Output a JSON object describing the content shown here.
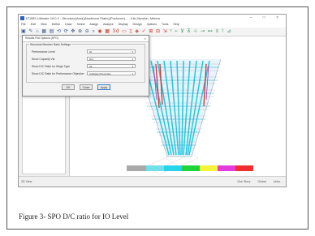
{
  "window": {
    "title": "ETABS Ultimate 18.0.2 - Structure(Area)(Nonlinear Static)(Pushover)... - Kilo-Newton, Meters",
    "controls": "– □ ×"
  },
  "menu": [
    "File",
    "Edit",
    "View",
    "Define",
    "Draw",
    "Select",
    "Assign",
    "Analyze",
    "Display",
    "Design",
    "Options",
    "Tools",
    "Help"
  ],
  "toolbar": {
    "icons_a": "▣ ✎ ⌂ ▦ ▤ ⟲ ⟳ ✥ ⊕ ⊖ ⌕",
    "icons_b": "◉ ▦ 3d ▭ ▯ ◈ ✓ ⊞ ⊟ ⇲",
    "icons_c": "ᵛ ⌁ ⊻ ⊼ ⊹ ⊸ ⊷ ≡ ⊺ ⊿"
  },
  "dialog": {
    "title": "Results Plot Options (SPO)",
    "close": "×",
    "group_caption": "Structural Member Ratio Settings",
    "rows": [
      {
        "label": "Performance Level",
        "value": "IO"
      },
      {
        "label": "Show Capacity Via",
        "value": "D/C"
      },
      {
        "label": "Show D/C Ratio for Hinge Type",
        "value": "All"
      },
      {
        "label": "Show D/C Ratio for Performance Objective",
        "value": "Collapse Prevention"
      }
    ],
    "buttons": {
      "ok": "OK",
      "close": "Close",
      "apply": "Apply"
    }
  },
  "status": {
    "left": "3D View",
    "right": [
      "One Story",
      "Global",
      "Units..."
    ]
  },
  "colorbar": [
    "#a9a9a9",
    "#6fdfe9",
    "#25d4e8",
    "#1fd33a",
    "#f7f23a",
    "#e43cdb",
    "#f02e2e"
  ],
  "caption": "Figure 3- SPO D/C ratio for IO Level"
}
